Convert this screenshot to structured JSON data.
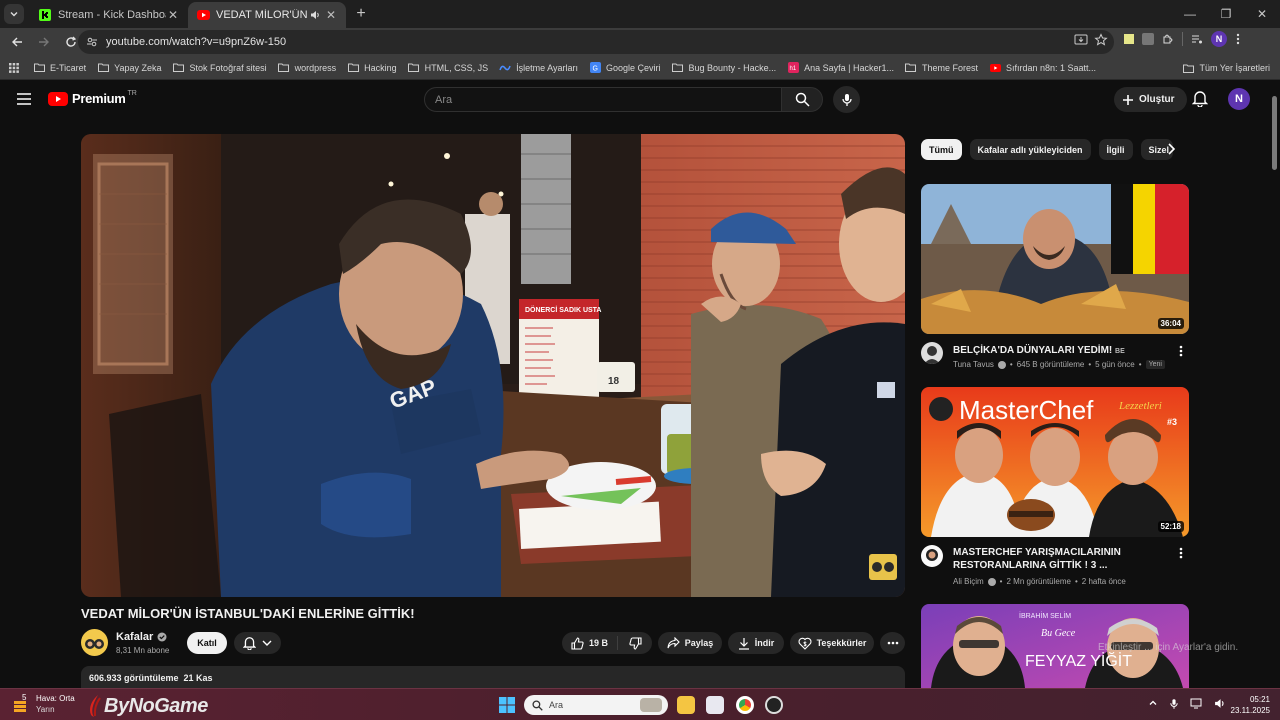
{
  "browser": {
    "tabs": [
      {
        "label": "Stream - Kick Dashboard",
        "active": false
      },
      {
        "label": "VEDAT MİLOR'ÜN İSTANBUL",
        "active": true
      }
    ],
    "url": "youtube.com/watch?v=u9pnZ6w-150",
    "profile_initial": "N",
    "bookmarks": [
      "E-Ticaret",
      "Yapay Zeka",
      "Stok Fotoğraf sitesi",
      "wordpress",
      "Hacking",
      "HTML, CSS, JS",
      "İşletme Ayarları",
      "Google Çeviri",
      "Bug Bounty - Hacke...",
      "Ana Sayfa | Hacker1...",
      "Theme Forest",
      "Sıfırdan n8n: 1 Saatt..."
    ],
    "bookmarks_right": "Tüm Yer İşaretleri"
  },
  "masthead": {
    "logo_text": "Premium",
    "country_code": "TR",
    "search_placeholder": "Ara",
    "create_label": "Oluştur",
    "avatar_initial": "N"
  },
  "video": {
    "title": "VEDAT MİLOR'ÜN İSTANBUL'DAKİ ENLERİNE GİTTİK!",
    "channel": "Kafalar",
    "subscribers": "8,31 Mn abone",
    "join_label": "Katıl",
    "likes": "19 B",
    "share_label": "Paylaş",
    "download_label": "İndir",
    "thanks_label": "Teşekkürler",
    "views_date": "606.933 görüntüleme  21 Kas",
    "sign_text": "DÖNERCİ SADIK USTA",
    "table_number": "18"
  },
  "chips": [
    {
      "label": "Tümü",
      "active": true
    },
    {
      "label": "Kafalar adlı yükleyiciden",
      "active": false
    },
    {
      "label": "İlgili",
      "active": false
    },
    {
      "label": "Sizel",
      "active": false
    }
  ],
  "recommendations": [
    {
      "title": "BELÇİKA'DA DÜNYALARI YEDİM!",
      "suffix": "BE",
      "channel": "Tuna Tavus",
      "views": "645 B görüntüleme",
      "age": "5 gün önce",
      "badge": "Yeni",
      "duration": "36:04"
    },
    {
      "title": "MASTERCHEF YARIŞMACILARININ RESTORANLARINA GİTTİK ! 3 ...",
      "channel": "Ali Biçim",
      "views": "2 Mn görüntüleme",
      "age": "2 hafta önce",
      "duration": "52:18",
      "thumb_text": "MasterChef",
      "thumb_sub": "#3",
      "thumb_script": "Lezzetleri"
    },
    {
      "thumb_name1": "İBRAHİM SELİM",
      "thumb_script": "Bu Gece",
      "thumb_name2": "FEYYAZ YİĞİT"
    }
  ],
  "activate_windows": "Etkinleştir ... için Ayarlar'a gidin.",
  "taskbar": {
    "weather_title": "Hava: Orta",
    "weather_sub": "Yarın",
    "weather_temp": "5",
    "brand": "ByNoGame",
    "search_placeholder": "Ara",
    "time": "05:21",
    "date": "23.11.2025"
  },
  "colors": {
    "youtube_red": "#ff0000",
    "background": "#0f0f0f",
    "chrome_frame": "#1f1f1f",
    "profile_purple": "#5e35b1",
    "taskbar": "#4b1f2c"
  }
}
